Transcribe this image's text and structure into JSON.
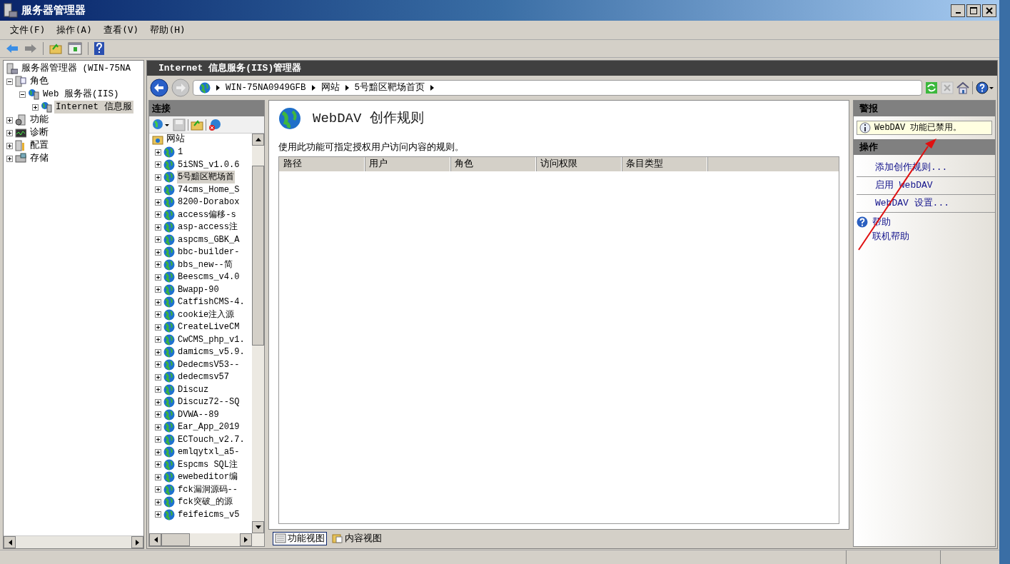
{
  "window": {
    "title": "服务器管理器"
  },
  "menu": [
    "文件(F)",
    "操作(A)",
    "查看(V)",
    "帮助(H)"
  ],
  "tree": [
    {
      "label": "服务器管理器 (WIN-75NA",
      "selected": false,
      "children": [
        {
          "label": "角色",
          "expanded": true,
          "selected": false,
          "children": [
            {
              "label": "Web 服务器(IIS)",
              "expanded": true,
              "selected": false,
              "children": [
                {
                  "label": "Internet 信息服",
                  "expanded": false,
                  "selected": true
                }
              ]
            }
          ]
        },
        {
          "label": "功能",
          "expanded": false,
          "selected": false
        },
        {
          "label": "诊断",
          "expanded": false,
          "selected": false
        },
        {
          "label": "配置",
          "expanded": false,
          "selected": false
        },
        {
          "label": "存储",
          "expanded": false,
          "selected": false
        }
      ]
    }
  ],
  "iis": {
    "title": "Internet 信息服务(IIS)管理器",
    "breadcrumb": [
      "WIN-75NA0949GFB",
      "网站",
      "5号黯区靶场首页"
    ]
  },
  "connections": {
    "title": "连接",
    "root": "网站",
    "sites": [
      {
        "label": "1",
        "selected": false
      },
      {
        "label": "5iSNS_v1.0.6",
        "selected": false
      },
      {
        "label": "5号黯区靶场首",
        "selected": true
      },
      {
        "label": "74cms_Home_S",
        "selected": false
      },
      {
        "label": "8200-Dorabox",
        "selected": false
      },
      {
        "label": "access偏移-s",
        "selected": false
      },
      {
        "label": "asp-access注",
        "selected": false
      },
      {
        "label": "aspcms_GBK_A",
        "selected": false
      },
      {
        "label": "bbc-builder-",
        "selected": false
      },
      {
        "label": "bbs_new--简",
        "selected": false
      },
      {
        "label": "Beescms_v4.0",
        "selected": false
      },
      {
        "label": "Bwapp-90",
        "selected": false
      },
      {
        "label": "CatfishCMS-4.",
        "selected": false
      },
      {
        "label": "cookie注入源",
        "selected": false
      },
      {
        "label": "CreateLiveCM",
        "selected": false
      },
      {
        "label": "CwCMS_php_v1.",
        "selected": false
      },
      {
        "label": "damicms_v5.9.",
        "selected": false
      },
      {
        "label": "DedecmsV53--",
        "selected": false
      },
      {
        "label": "dedecmsv57",
        "selected": false
      },
      {
        "label": "Discuz",
        "selected": false
      },
      {
        "label": "Discuz72--SQ",
        "selected": false
      },
      {
        "label": "DVWA--89",
        "selected": false
      },
      {
        "label": "Ear_App_2019",
        "selected": false
      },
      {
        "label": "ECTouch_v2.7.",
        "selected": false
      },
      {
        "label": "emlqytxl_a5-",
        "selected": false
      },
      {
        "label": "Espcms SQL注",
        "selected": false
      },
      {
        "label": "ewebeditor编",
        "selected": false
      },
      {
        "label": "fck漏洞源码--",
        "selected": false
      },
      {
        "label": "fck突破_的源",
        "selected": false
      },
      {
        "label": "feifeicms_v5",
        "selected": false
      }
    ]
  },
  "feature": {
    "title": "WebDAV 创作规则",
    "description": "使用此功能可指定授权用户访问内容的规则。",
    "table": {
      "columns": [
        "路径",
        "用户",
        "角色",
        "访问权限",
        "条目类型"
      ]
    }
  },
  "view_tabs": [
    {
      "label": "功能视图",
      "selected": true
    },
    {
      "label": "内容视图",
      "selected": false
    }
  ],
  "alerts": {
    "title": "警报",
    "items": [
      "WebDAV 功能已禁用。"
    ]
  },
  "actions": {
    "title": "操作",
    "items": [
      {
        "kind": "link",
        "label": "添加创作规则..."
      },
      {
        "kind": "link",
        "label": "启用 WebDAV"
      },
      {
        "kind": "link",
        "label": "WebDAV 设置..."
      },
      {
        "kind": "help",
        "label": "帮助"
      },
      {
        "kind": "plain",
        "label": "联机帮助"
      }
    ]
  }
}
